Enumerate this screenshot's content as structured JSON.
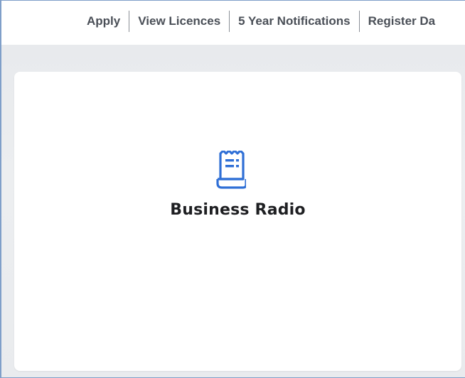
{
  "nav": {
    "items": [
      {
        "label": "Apply"
      },
      {
        "label": "View Licences"
      },
      {
        "label": "5 Year Notifications"
      },
      {
        "label": "Register Da"
      }
    ]
  },
  "card": {
    "title": "Business Radio",
    "icon": "receipt-icon"
  },
  "colors": {
    "accent": "#2f6fd6",
    "nav_text": "#4a4f57",
    "page_bg": "#e9ebee",
    "frame_border": "#7f9fc9"
  }
}
